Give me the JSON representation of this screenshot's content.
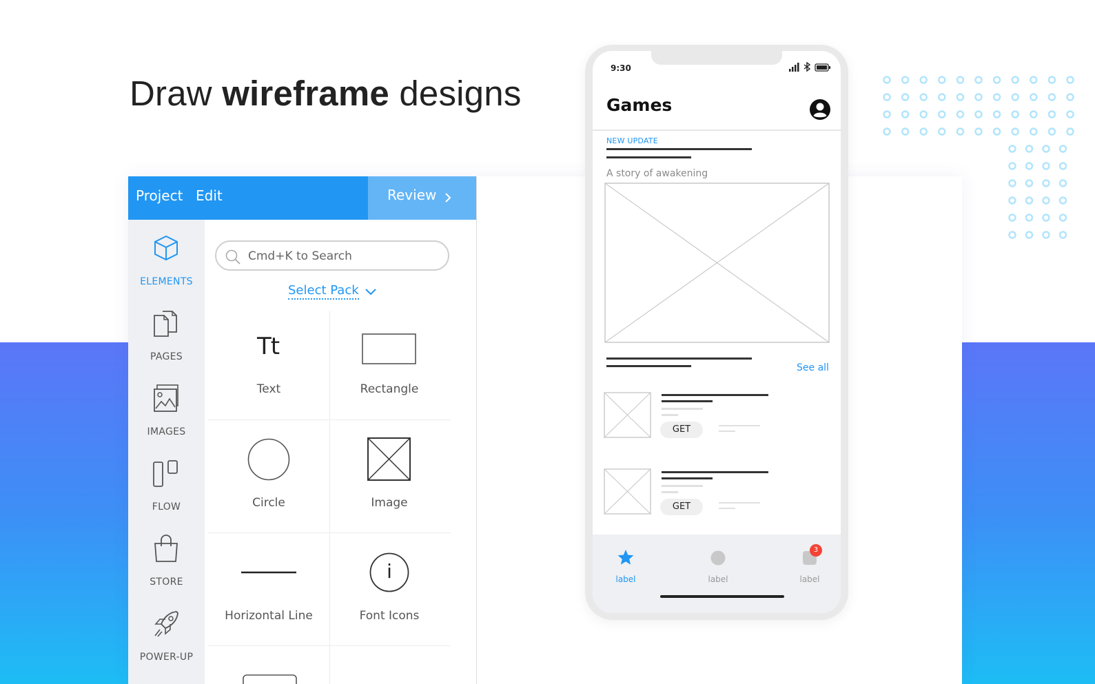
{
  "headline": {
    "prefix": "Draw",
    "bold": "wireframe",
    "suffix": "designs"
  },
  "editor": {
    "menu": [
      "Project",
      "Edit"
    ],
    "review_label": "Review",
    "sidebar": [
      {
        "label": "ELEMENTS",
        "icon": "cube-icon",
        "active": true
      },
      {
        "label": "PAGES",
        "icon": "pages-icon"
      },
      {
        "label": "IMAGES",
        "icon": "images-icon"
      },
      {
        "label": "FLOW",
        "icon": "flow-icon"
      },
      {
        "label": "STORE",
        "icon": "shopping-bag-icon"
      },
      {
        "label": "POWER-UP",
        "icon": "rocket-icon"
      }
    ],
    "search_placeholder": "Cmd+K to Search",
    "select_pack": "Select Pack",
    "elements": [
      "Text",
      "Rectangle",
      "Circle",
      "Image",
      "Horizontal Line",
      "Font Icons"
    ],
    "text_glyph": "Tt",
    "info_glyph": "i"
  },
  "phone": {
    "time": "9:30",
    "title": "Games",
    "section_tag": "NEW UPDATE",
    "subtitle": "A story of awakening",
    "see_all": "See all",
    "get_label": "GET",
    "tabs": [
      "label",
      "label",
      "label"
    ],
    "badge_count": "3"
  },
  "colors": {
    "accent": "#2196f3",
    "review": "#64b5f6",
    "badge": "#f44336",
    "gradient_top": "#5b76f8",
    "gradient_bottom": "#1dbdf5",
    "dots": "#b3e5fc"
  }
}
